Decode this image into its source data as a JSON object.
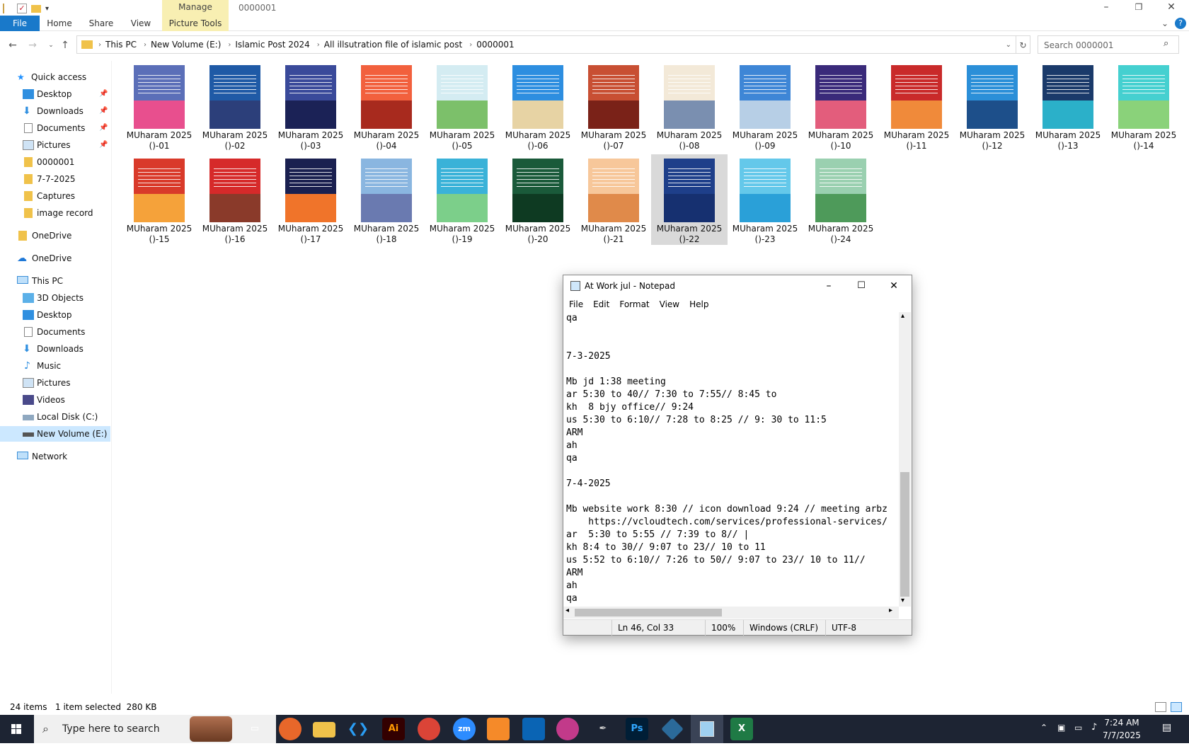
{
  "window": {
    "folder_title": "0000001",
    "manage_tab": "Manage"
  },
  "ribbon": {
    "tabs": [
      "File",
      "Home",
      "Share",
      "View",
      "Picture Tools"
    ],
    "help": "?"
  },
  "address": {
    "crumbs": [
      "This PC",
      "New Volume (E:)",
      "Islamic Post 2024",
      "All illsutration file of islamic post",
      "0000001"
    ]
  },
  "search": {
    "placeholder": "Search 0000001"
  },
  "nav": {
    "quick_access": "Quick access",
    "pinned": [
      "Desktop",
      "Downloads",
      "Documents",
      "Pictures"
    ],
    "folders": [
      "0000001",
      "7-7-2025",
      "Captures",
      "image record"
    ],
    "onedrive1": "OneDrive",
    "onedrive2": "OneDrive",
    "this_pc": "This PC",
    "pc_items": [
      "3D Objects",
      "Desktop",
      "Documents",
      "Downloads",
      "Music",
      "Pictures",
      "Videos",
      "Local Disk (C:)",
      "New Volume (E:)"
    ],
    "network": "Network"
  },
  "files": [
    {
      "line1": "MUharam 2025",
      "line2": "()-01",
      "top": "#5b6fb8",
      "bot": "#e84f8e"
    },
    {
      "line1": "MUharam 2025",
      "line2": "()-02",
      "top": "#1f5aa6",
      "bot": "#2c3f7a"
    },
    {
      "line1": "MUharam 2025",
      "line2": "()-03",
      "top": "#3a4a9a",
      "bot": "#1b2256"
    },
    {
      "line1": "MUharam 2025",
      "line2": "()-04",
      "top": "#f2603d",
      "bot": "#a82a1e"
    },
    {
      "line1": "MUharam 2025",
      "line2": "()-05",
      "top": "#d4ecf2",
      "bot": "#7cc06a"
    },
    {
      "line1": "MUharam 2025",
      "line2": "()-06",
      "top": "#2d8ee0",
      "bot": "#e7d3a4"
    },
    {
      "line1": "MUharam 2025",
      "line2": "()-07",
      "top": "#c84f33",
      "bot": "#7a2218"
    },
    {
      "line1": "MUharam 2025",
      "line2": "()-08",
      "top": "#f3e9d8",
      "bot": "#7a8fb0"
    },
    {
      "line1": "MUharam 2025",
      "line2": "()-09",
      "top": "#3e86d6",
      "bot": "#b7cfe6"
    },
    {
      "line1": "MUharam 2025",
      "line2": "()-10",
      "top": "#3a2a7a",
      "bot": "#e35d7c"
    },
    {
      "line1": "MUharam 2025",
      "line2": "()-11",
      "top": "#c92a2a",
      "bot": "#f08a3a"
    },
    {
      "line1": "MUharam 2025",
      "line2": "()-12",
      "top": "#2b8fd8",
      "bot": "#1d4f8a"
    },
    {
      "line1": "MUharam 2025",
      "line2": "()-13",
      "top": "#1a3a6a",
      "bot": "#2bb0c9"
    },
    {
      "line1": "MUharam 2025",
      "line2": "()-14",
      "top": "#45d0d0",
      "bot": "#8ad27a"
    },
    {
      "line1": "MUharam 2025",
      "line2": "()-15",
      "top": "#d93a2a",
      "bot": "#f5a23a"
    },
    {
      "line1": "MUharam 2025",
      "line2": "()-16",
      "top": "#d62a2a",
      "bot": "#8a3a2a"
    },
    {
      "line1": "MUharam 2025",
      "line2": "()-17",
      "top": "#1a2050",
      "bot": "#f0742a"
    },
    {
      "line1": "MUharam 2025",
      "line2": "()-18",
      "top": "#8ab6e0",
      "bot": "#6a7ab0"
    },
    {
      "line1": "MUharam 2025",
      "line2": "()-19",
      "top": "#3ab2d8",
      "bot": "#7ccf8a"
    },
    {
      "line1": "MUharam 2025",
      "line2": "()-20",
      "top": "#1a5a3a",
      "bot": "#0e3a22"
    },
    {
      "line1": "MUharam 2025",
      "line2": "()-21",
      "top": "#f7c79a",
      "bot": "#e08a4a"
    },
    {
      "line1": "MUharam 2025",
      "line2": "()-22",
      "top": "#1e3f8a",
      "bot": "#163070"
    },
    {
      "line1": "MUharam 2025",
      "line2": "()-23",
      "top": "#64c8ea",
      "bot": "#2aa0d8"
    },
    {
      "line1": "MUharam 2025",
      "line2": "()-24",
      "top": "#9ad0b0",
      "bot": "#4e9a5a"
    }
  ],
  "notepad": {
    "title": "At Work jul - Notepad",
    "menu": [
      "File",
      "Edit",
      "Format",
      "View",
      "Help"
    ],
    "lines": [
      "qa",
      "",
      "",
      "7-3-2025",
      "",
      "Mb jd 1:38 meeting",
      "ar 5:30 to 40// 7:30 to 7:55// 8:45 to",
      "kh  8 bjy office// 9:24",
      "us 5:30 to 6:10// 7:28 to 8:25 // 9: 30 to 11:5",
      "ARM",
      "ah",
      "qa",
      "",
      "7-4-2025",
      "",
      "Mb website work 8:30 // icon download 9:24 // meeting arbz",
      "    https://vcloudtech.com/services/professional-services/",
      "ar  5:30 to 5:55 // 7:39 to 8// |",
      "kh 8:4 to 30// 9:07 to 23// 10 to 11",
      "us 5:52 to 6:10// 7:26 to 50// 9:07 to 23// 10 to 11//",
      "ARM",
      "ah",
      "qa"
    ],
    "status": {
      "position": "Ln 46, Col 33",
      "zoom": "100%",
      "eol": "Windows (CRLF)",
      "encoding": "UTF-8"
    }
  },
  "statusbar": {
    "items": "24 items",
    "selected": "1 item selected  280 KB"
  },
  "taskbar": {
    "search": "Type here to search",
    "time": "7:24 AM",
    "date": "7/7/2025",
    "apps": [
      "Ai",
      "zm",
      "Ps"
    ]
  }
}
